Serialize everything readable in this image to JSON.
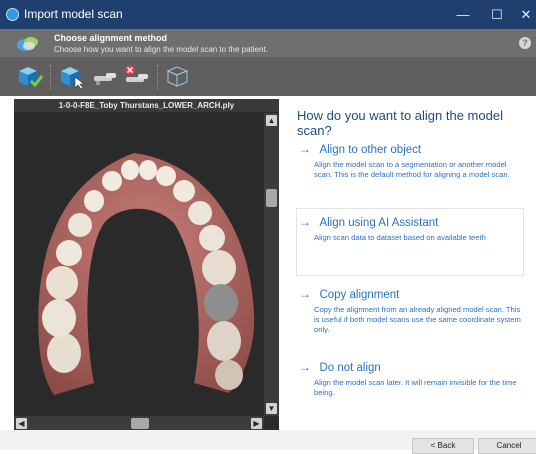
{
  "window": {
    "title": "Import model scan",
    "minimize_glyph": "—",
    "maximize_glyph": "☐",
    "close_glyph": "✕"
  },
  "header": {
    "title": "Choose alignment method",
    "subtitle": "Choose how you want to align the model scan to the patient.",
    "help_glyph": "?"
  },
  "toolbar": {
    "icons": [
      "model-scan-checked-icon",
      "model-scan-select-icon",
      "scanner-icon",
      "scanner-disabled-icon",
      "cube-wireframe-icon"
    ]
  },
  "viewer": {
    "title": "1-0-0-F8E_Toby Thurstans_LOWER_ARCH.ply",
    "scroll_up": "▲",
    "scroll_down": "▼",
    "scroll_left": "◀",
    "scroll_right": "▶"
  },
  "main": {
    "question": "How do you want to align the model scan?",
    "arrow_glyph": "→",
    "options": [
      {
        "title": "Align to other object",
        "description": "Align the model scan to a segmentation or another model scan. This is the default method for aligning a model scan."
      },
      {
        "title": "Align using AI Assistant",
        "description": "Align scan data to dataset based on available teeth"
      },
      {
        "title": "Copy alignment",
        "description": "Copy the alignment from an already aligned model scan. This is useful if both model scans use the same coordinate system only."
      },
      {
        "title": "Do not align",
        "description": "Align the model scan later. It will remain invisible for the time being."
      }
    ]
  },
  "footer": {
    "back_label": "< Back",
    "cancel_label": "Cancel"
  },
  "colors": {
    "titlebar": "#1f3f6e",
    "link_blue": "#2b72c4",
    "header_gray": "#6f6f6f",
    "toolbar_gray": "#5f5f5f"
  }
}
